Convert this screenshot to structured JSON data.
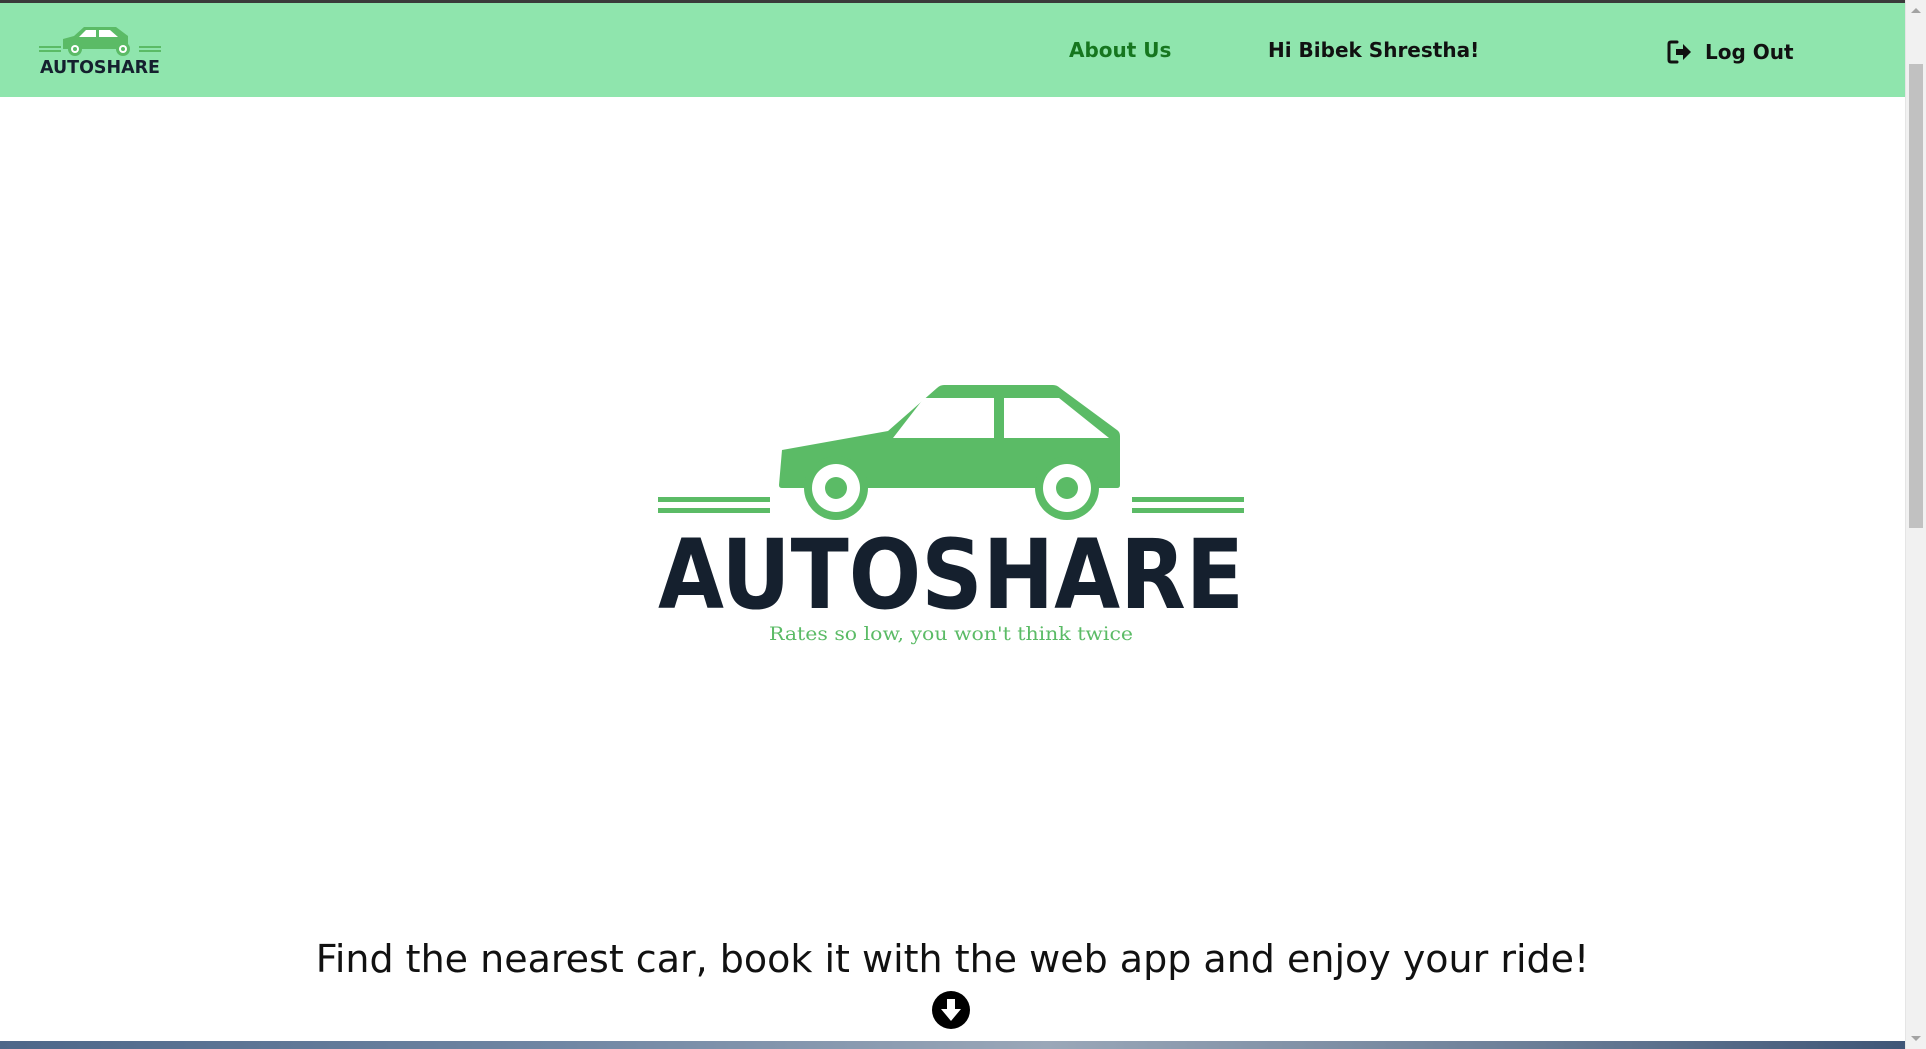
{
  "navbar": {
    "logo_text": "AUTOSHARE",
    "about_label": "About Us",
    "greeting": "Hi Bibek Shrestha!",
    "logout_label": "Log Out",
    "logout_icon": "sign-out-icon"
  },
  "hero": {
    "brand_name": "AUTOSHARE",
    "tagline": "Rates so low, you won't think twice",
    "headline": "Find the nearest car, book it with the web app and enjoy your ride!",
    "scroll_icon": "arrow-circle-down-icon"
  },
  "colors": {
    "navbar_bg": "#8fe5ad",
    "brand_green": "#5bbb66",
    "brand_dark": "#15202e",
    "about_link": "#16761f"
  }
}
